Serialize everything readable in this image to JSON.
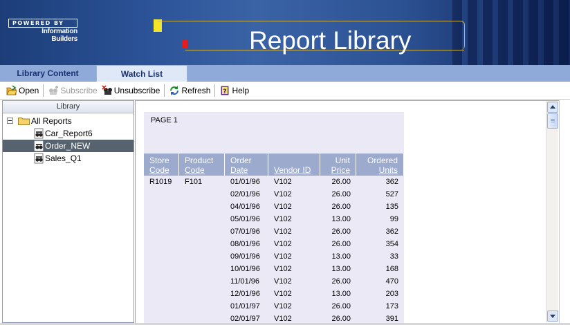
{
  "header": {
    "logo_top": "POWERED BY",
    "logo_brand_line1": "Information",
    "logo_brand_line2": "Builders",
    "title": "Report Library"
  },
  "tabs": [
    {
      "label": "Library Content",
      "active": false
    },
    {
      "label": "Watch List",
      "active": true
    }
  ],
  "toolbar": {
    "open": "Open",
    "subscribe": "Subscribe",
    "unsubscribe": "Unsubscribe",
    "refresh": "Refresh",
    "help": "Help"
  },
  "library": {
    "header": "Library",
    "root": "All Reports",
    "items": [
      {
        "label": "Car_Report6",
        "selected": false
      },
      {
        "label": "Order_NEW",
        "selected": true
      },
      {
        "label": "Sales_Q1",
        "selected": false
      }
    ]
  },
  "report": {
    "page_label": "PAGE 1",
    "columns": [
      {
        "line1": "Store",
        "line2": "Code",
        "align": "lft"
      },
      {
        "line1": "Product",
        "line2": "Code",
        "align": "lft"
      },
      {
        "line1": "Order",
        "line2": "Date",
        "align": "lft"
      },
      {
        "line1": "",
        "line2": "Vendor ID",
        "align": "lft"
      },
      {
        "line1": "Unit",
        "line2": "Price",
        "align": "num"
      },
      {
        "line1": "Ordered",
        "line2": "Units",
        "align": "num"
      }
    ],
    "rows": [
      [
        "R1019",
        "F101",
        "01/01/96",
        "V102",
        "26.00",
        "362"
      ],
      [
        "",
        "",
        "02/01/96",
        "V102",
        "26.00",
        "527"
      ],
      [
        "",
        "",
        "04/01/96",
        "V102",
        "26.00",
        "135"
      ],
      [
        "",
        "",
        "05/01/96",
        "V102",
        "13.00",
        "99"
      ],
      [
        "",
        "",
        "07/01/96",
        "V102",
        "26.00",
        "362"
      ],
      [
        "",
        "",
        "08/01/96",
        "V102",
        "26.00",
        "354"
      ],
      [
        "",
        "",
        "09/01/96",
        "V102",
        "13.00",
        "33"
      ],
      [
        "",
        "",
        "10/01/96",
        "V102",
        "13.00",
        "168"
      ],
      [
        "",
        "",
        "11/01/96",
        "V102",
        "26.00",
        "470"
      ],
      [
        "",
        "",
        "12/01/96",
        "V102",
        "13.00",
        "203"
      ],
      [
        "",
        "",
        "01/01/97",
        "V102",
        "26.00",
        "173"
      ],
      [
        "",
        "",
        "02/01/97",
        "V102",
        "26.00",
        "391"
      ]
    ]
  },
  "colors": {
    "banner": "#2b5296",
    "tabbar": "#8faad9",
    "selected_row": "#56636f",
    "report_bg": "#ece9f7",
    "table_header": "#9baacd"
  }
}
